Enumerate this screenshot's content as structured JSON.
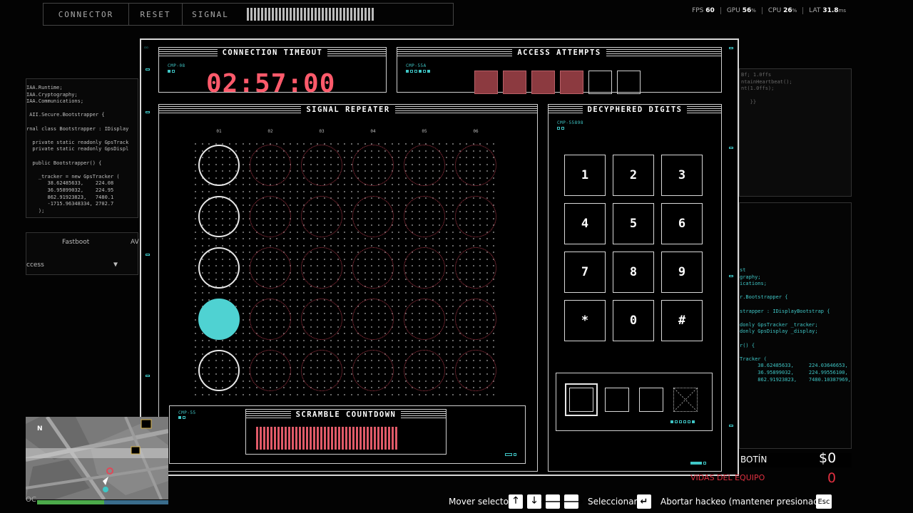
{
  "topbar": {
    "tabs": [
      "CONNECTOR",
      "RESET",
      "SIGNAL"
    ]
  },
  "stats": [
    {
      "label": "FPS",
      "value": "60"
    },
    {
      "label": "GPU",
      "value": "56",
      "unit": "%"
    },
    {
      "label": "CPU",
      "value": "26",
      "unit": "%"
    },
    {
      "label": "LAT",
      "value": "31.8",
      "unit": "ms"
    }
  ],
  "left_code": [
    "IAA.Runtime;",
    "IAA.Cryptography;",
    "IAA.Communications;",
    "",
    " AII.Secure.Bootstrapper {",
    "",
    "rnal class Bootstrapper : IDisplay",
    "",
    "  private static readonly GpsTrack",
    "  private static readonly GpsDispl",
    "",
    "  public Bootstrapper() {",
    "",
    "    _tracker = new GpsTracker (",
    "       38.62485633,    224.08",
    "       36.95899032,    224.95",
    "       862.91923823,   7480.1",
    "       -1715.96348334, 2702.7",
    "    );"
  ],
  "left_menu": {
    "fastboot": "Fastboot",
    "av": "AV",
    "access": "ccess"
  },
  "right_code_top": [
    "Bf; 1.0ffs",
    "ntainHeartbeat();",
    "nt(1.0ffs);",
    "",
    "   }}"
  ],
  "right_code_cyan": [
    "st",
    "graphy;",
    "ications;",
    "",
    "r.Bootstrapper {",
    "",
    "strapper : IDisplayBootstrap {",
    "",
    "donly GpsTracker _tracker;",
    "donly GpsDisplay _display;",
    "",
    "r() {",
    "",
    "Tracker (",
    "      38.62485633,     224.03646653,",
    "      36.95899032,     224.99556100,",
    "      862.91923823,    7480.10387969,"
  ],
  "connection_timeout": {
    "title": "CONNECTION TIMEOUT",
    "code": "CMP-08",
    "time": "02:57:00"
  },
  "access_attempts": {
    "title": "ACCESS ATTEMPTS",
    "code": "CMP-55A",
    "total": 6,
    "used": 4
  },
  "signal_repeater": {
    "title": "SIGNAL REPEATER",
    "columns": [
      "01",
      "02",
      "03",
      "04",
      "05",
      "06"
    ],
    "rows": 5,
    "active_row": 4
  },
  "scramble": {
    "code": "CMP-55",
    "title": "SCRAMBLE COUNTDOWN",
    "segments": 40,
    "filled": 40
  },
  "decyphered": {
    "title": "DECYPHERED DIGITS",
    "code": "CMP-55898",
    "keys": [
      "1",
      "2",
      "3",
      "4",
      "5",
      "6",
      "7",
      "8",
      "9",
      "*",
      "0",
      "#"
    ]
  },
  "hud": {
    "botin_label": "BOTÍN",
    "botin_value": "$0",
    "vidas_label": "VIDAS DEL EQUIPO",
    "vidas_value": "0",
    "map_north": "N",
    "oc": "OC"
  },
  "controls": {
    "move": "Mover selector",
    "select": "Seleccionar",
    "abort": "Abortar hackeo (mantener presionado)",
    "esc": "Esc"
  },
  "colors": {
    "accent_red": "#ff5a6b",
    "accent_cyan": "#4fd2d2",
    "used_attempt": "#8c3a40"
  }
}
